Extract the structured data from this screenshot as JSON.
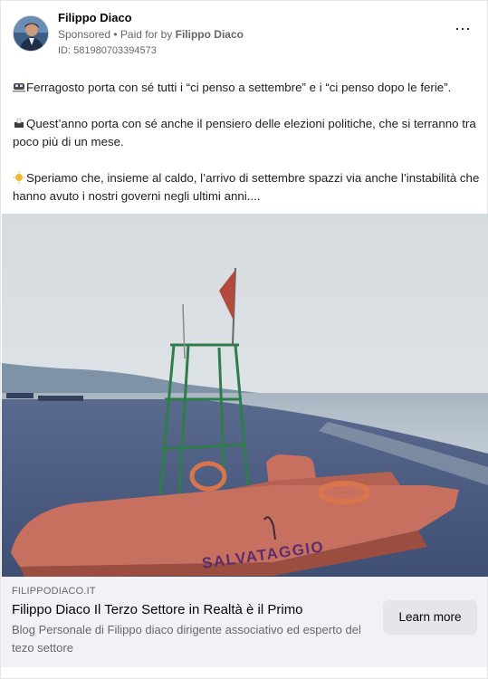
{
  "post": {
    "author": "Filippo Diaco",
    "sponsored_label": "Sponsored",
    "paid_for_prefix": " • Paid for by ",
    "paid_for_name": "Filippo Diaco",
    "ad_id": "ID: 581980703394573",
    "more_icon": "⋯",
    "paragraphs": [
      "Ferragosto porta con sé tutti i “ci penso a settembre” e i “ci penso dopo le ferie”.",
      "Quest’anno porta con sé anche il pensiero delle elezioni politiche, che si terranno tra poco più di un mese.",
      "Speriamo che, insieme al caldo, l’arrivo di settembre spazzi via anche l’instabilità che hanno avuto i nostri governi negli ultimi anni...."
    ],
    "image_boat_text": "SALVATAGGIO"
  },
  "link_preview": {
    "domain": "FILIPPODIACO.IT",
    "title": "Filippo Diaco Il Terzo Settore in Realtà è il Primo",
    "description": "Blog Personale di Filippo diaco dirigente associativo ed esperto del tezo settore",
    "cta_label": "Learn more"
  },
  "colors": {
    "secondary_text": "#65676b",
    "footer_bg": "#f0f2f5",
    "cta_bg": "#e4e6eb",
    "boat": "#c8705f",
    "boat_text": "#5a2d6e"
  }
}
